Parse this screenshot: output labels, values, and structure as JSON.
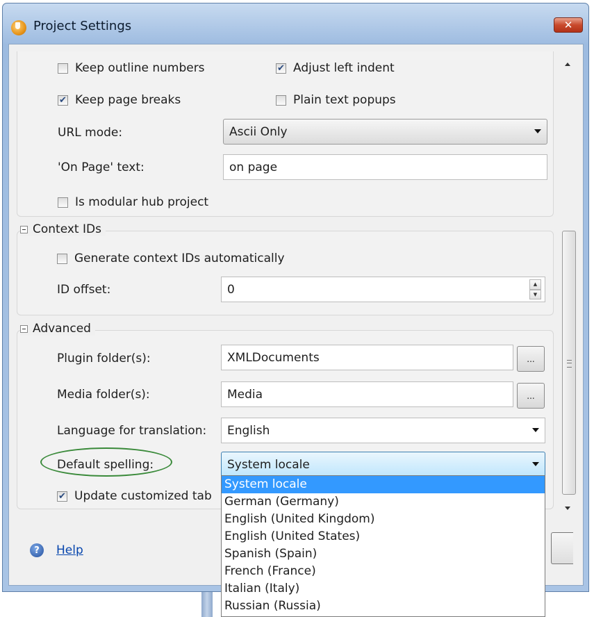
{
  "window": {
    "title": "Project Settings",
    "close_label": "✕"
  },
  "general": {
    "keep_outline_numbers": {
      "label": "Keep outline numbers",
      "checked": false
    },
    "adjust_left_indent": {
      "label": "Adjust left indent",
      "checked": true
    },
    "keep_page_breaks": {
      "label": "Keep page breaks",
      "checked": true
    },
    "plain_text_popups": {
      "label": "Plain text popups",
      "checked": false
    },
    "url_mode": {
      "label": "URL mode:",
      "value": "Ascii Only"
    },
    "on_page_text": {
      "label": "'On Page' text:",
      "value": "on page"
    },
    "modular_hub": {
      "label": "Is modular hub project",
      "checked": false
    }
  },
  "context_ids": {
    "section_label": "Context IDs",
    "generate": {
      "label": "Generate context IDs automatically",
      "checked": false
    },
    "id_offset": {
      "label": "ID offset:",
      "value": "0"
    }
  },
  "advanced": {
    "section_label": "Advanced",
    "plugin_folder": {
      "label": "Plugin folder(s):",
      "value": "XMLDocuments",
      "browse": "..."
    },
    "media_folder": {
      "label": "Media folder(s):",
      "value": "Media",
      "browse": "..."
    },
    "language": {
      "label": "Language for translation:",
      "value": "English"
    },
    "default_spelling": {
      "label": "Default spelling:",
      "value": "System locale"
    },
    "update_customized": {
      "label": "Update customized tab",
      "checked": true
    }
  },
  "spelling_options": [
    "System locale",
    "German (Germany)",
    "English (United Kingdom)",
    "English (United States)",
    "Spanish (Spain)",
    "French (France)",
    "Italian (Italy)",
    "Russian (Russia)"
  ],
  "spelling_selected_index": 0,
  "help": {
    "label": "Help"
  },
  "colors": {
    "selection": "#3399ff",
    "highlight_ellipse": "#3a8a3a",
    "link": "#0645ad"
  }
}
